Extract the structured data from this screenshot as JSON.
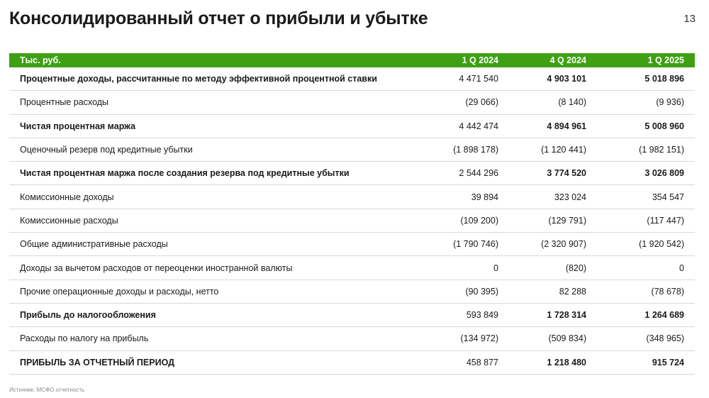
{
  "page": {
    "title": "Консолидированный отчет о прибыли и убытке",
    "number": "13",
    "footnote": "Источник: МСФО отчетность"
  },
  "colors": {
    "header_bg": "#3fa014",
    "header_text": "#ffffff",
    "row_border": "#d9d9d9"
  },
  "table": {
    "headers": [
      "Тыс. руб.",
      "1 Q 2024",
      "4 Q 2024",
      "1 Q 2025"
    ],
    "rows": [
      {
        "label": "Процентные доходы, рассчитанные по методу эффективной процентной ставки",
        "q1_2024": "4 471 540",
        "q4_2024": "4 903 101",
        "q1_2025": "5 018 896",
        "bold": true
      },
      {
        "label": "Процентные расходы",
        "q1_2024": "(29 066)",
        "q4_2024": "(8 140)",
        "q1_2025": "(9 936)",
        "bold": false
      },
      {
        "label": "Чистая процентная маржа",
        "q1_2024": "4 442 474",
        "q4_2024": "4 894 961",
        "q1_2025": "5 008 960",
        "bold": true
      },
      {
        "label": "Оценочный резерв под кредитные убытки",
        "q1_2024": "(1 898 178)",
        "q4_2024": "(1 120 441)",
        "q1_2025": "(1 982 151)",
        "bold": false
      },
      {
        "label": "Чистая процентная маржа после создания резерва под кредитные убытки",
        "q1_2024": "2 544 296",
        "q4_2024": "3 774 520",
        "q1_2025": "3 026 809",
        "bold": true
      },
      {
        "label": "Комиссионные доходы",
        "q1_2024": "39 894",
        "q4_2024": "323 024",
        "q1_2025": "354 547",
        "bold": false
      },
      {
        "label": "Комиссионные расходы",
        "q1_2024": "(109 200)",
        "q4_2024": "(129 791)",
        "q1_2025": "(117 447)",
        "bold": false
      },
      {
        "label": "Общие административные расходы",
        "q1_2024": "(1 790 746)",
        "q4_2024": "(2 320 907)",
        "q1_2025": "(1 920 542)",
        "bold": false
      },
      {
        "label": "Доходы за вычетом расходов от переоценки иностранной валюты",
        "q1_2024": "0",
        "q4_2024": "(820)",
        "q1_2025": "0",
        "bold": false
      },
      {
        "label": "Прочие операционные доходы и расходы, нетто",
        "q1_2024": "(90 395)",
        "q4_2024": "82 288",
        "q1_2025": "(78 678)",
        "bold": false
      },
      {
        "label": "Прибыль до налогообложения",
        "q1_2024": "593 849",
        "q4_2024": "1 728 314",
        "q1_2025": "1 264 689",
        "bold": true
      },
      {
        "label": "Расходы по налогу на прибыль",
        "q1_2024": "(134 972)",
        "q4_2024": "(509 834)",
        "q1_2025": "(348 965)",
        "bold": false
      },
      {
        "label": "ПРИБЫЛЬ ЗА ОТЧЕТНЫЙ ПЕРИОД",
        "q1_2024": "458 877",
        "q4_2024": "1 218 480",
        "q1_2025": "915 724",
        "bold": true
      }
    ]
  }
}
